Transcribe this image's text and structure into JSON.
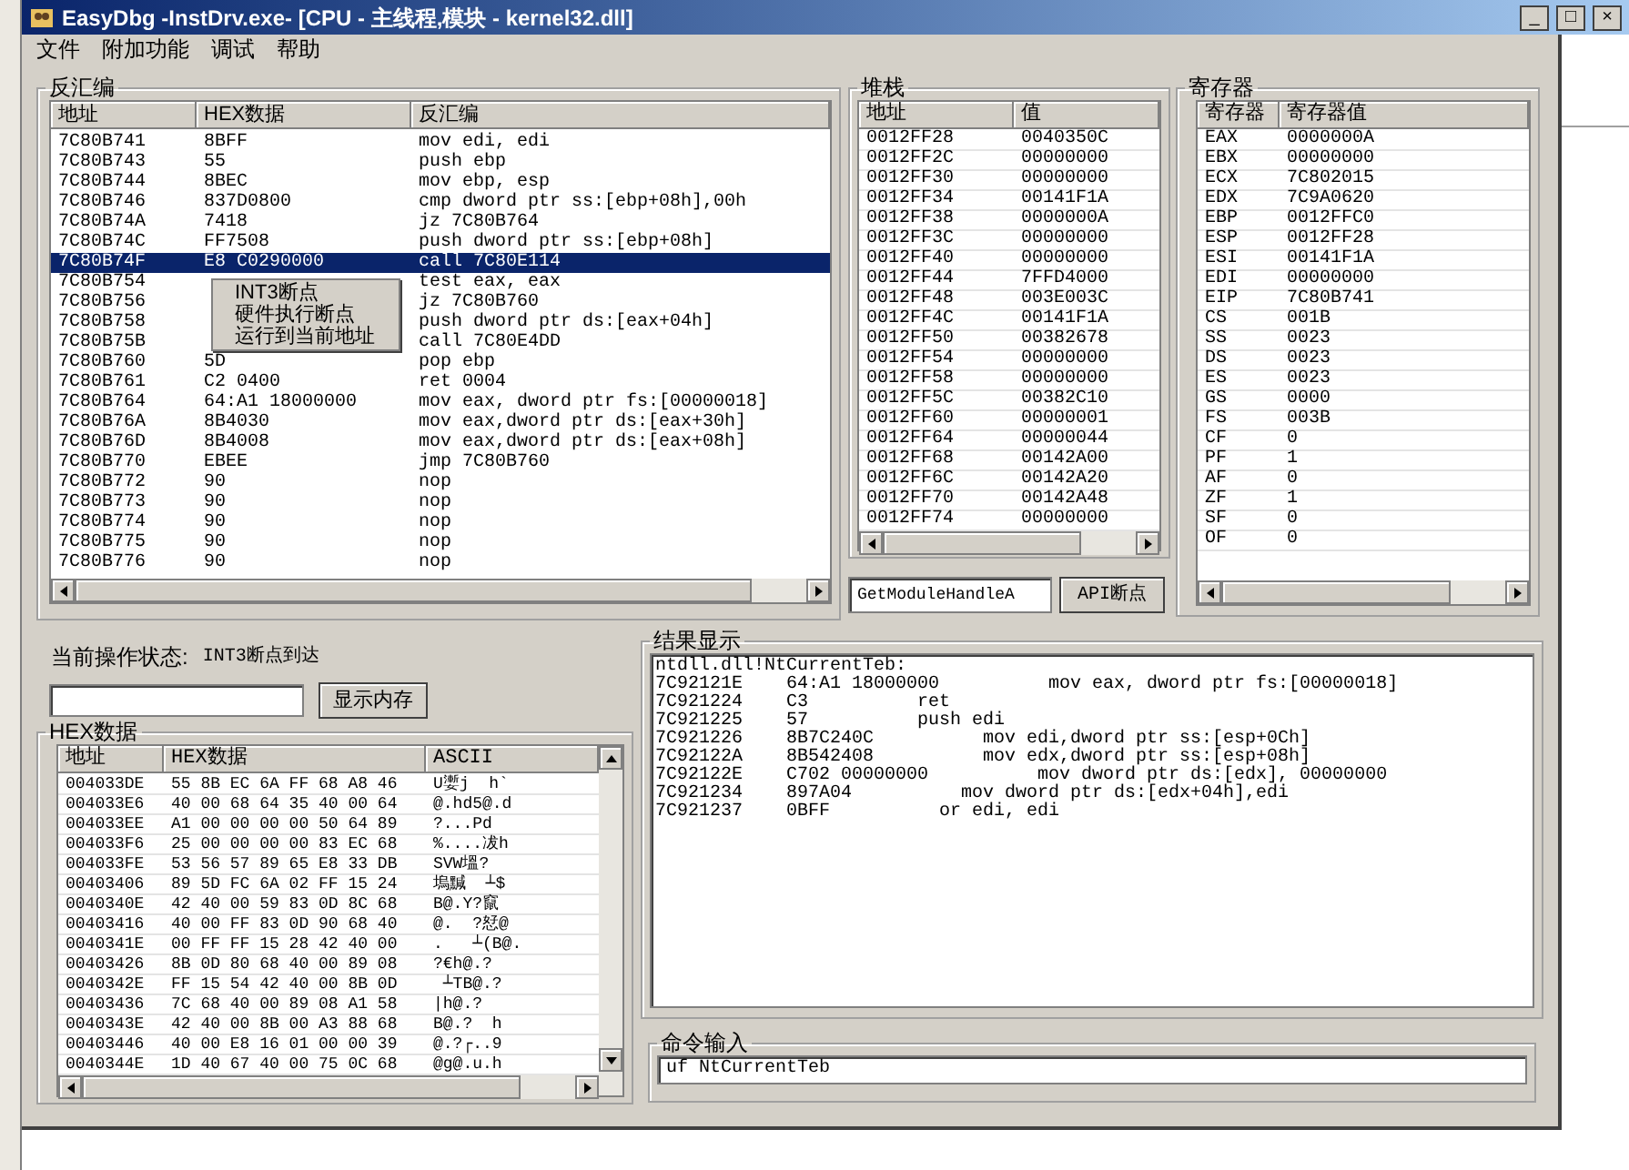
{
  "window": {
    "title": "EasyDbg -InstDrv.exe- [CPU - 主线程,模块 - kernel32.dll]",
    "controls": [
      "_",
      "□",
      "×"
    ]
  },
  "menu": [
    "文件",
    "附加功能",
    "调试",
    "帮助"
  ],
  "disassembly": {
    "label": "反汇编",
    "columns": [
      "地址",
      "HEX数据",
      "反汇编"
    ],
    "rows": [
      {
        "address": "7C80B741",
        "hex": "8BFF",
        "asm": "mov edi, edi",
        "selected": false
      },
      {
        "address": "7C80B743",
        "hex": "55",
        "asm": "push ebp",
        "selected": false
      },
      {
        "address": "7C80B744",
        "hex": "8BEC",
        "asm": "mov ebp, esp",
        "selected": false
      },
      {
        "address": "7C80B746",
        "hex": "837D0800",
        "asm": "cmp dword ptr ss:[ebp+08h],00h",
        "selected": false
      },
      {
        "address": "7C80B74A",
        "hex": "7418",
        "asm": "jz 7C80B764",
        "selected": false
      },
      {
        "address": "7C80B74C",
        "hex": "FF7508",
        "asm": "push dword ptr ss:[ebp+08h]",
        "selected": false
      },
      {
        "address": "7C80B74F",
        "hex": "E8 C0290000",
        "asm": "call 7C80E114",
        "selected": true
      },
      {
        "address": "7C80B754",
        "asm": "test eax, eax",
        "selected": false
      },
      {
        "address": "7C80B756",
        "asm": "jz 7C80B760",
        "selected": false
      },
      {
        "address": "7C80B758",
        "asm": "push dword ptr ds:[eax+04h]",
        "selected": false
      },
      {
        "address": "7C80B75B",
        "asm": "call 7C80E4DD",
        "selected": false
      },
      {
        "address": "7C80B760",
        "hex": "5D",
        "asm": "pop ebp",
        "selected": false
      },
      {
        "address": "7C80B761",
        "hex": "C2 0400",
        "asm": "ret 0004",
        "selected": false
      },
      {
        "address": "7C80B764",
        "hex": "64:A1 18000000",
        "asm": "mov eax, dword ptr fs:[00000018]",
        "selected": false
      },
      {
        "address": "7C80B76A",
        "hex": "8B4030",
        "asm": "mov eax,dword ptr ds:[eax+30h]",
        "selected": false
      },
      {
        "address": "7C80B76D",
        "hex": "8B4008",
        "asm": "mov eax,dword ptr ds:[eax+08h]",
        "selected": false
      },
      {
        "address": "7C80B770",
        "hex": "EBEE",
        "asm": "jmp 7C80B760",
        "selected": false
      },
      {
        "address": "7C80B772",
        "hex": "90",
        "asm": "nop",
        "selected": false
      },
      {
        "address": "7C80B773",
        "hex": "90",
        "asm": "nop",
        "selected": false
      },
      {
        "address": "7C80B774",
        "hex": "90",
        "asm": "nop",
        "selected": false
      },
      {
        "address": "7C80B775",
        "hex": "90",
        "asm": "nop",
        "selected": false
      },
      {
        "address": "7C80B776",
        "hex": "90",
        "asm": "nop",
        "selected": false
      }
    ]
  },
  "context_menu": [
    "INT3断点",
    "硬件执行断点",
    "运行到当前地址"
  ],
  "stack": {
    "label": "堆栈",
    "columns": [
      "地址",
      "值"
    ],
    "rows": [
      [
        "0012FF28",
        "0040350C"
      ],
      [
        "0012FF2C",
        "00000000"
      ],
      [
        "0012FF30",
        "00000000"
      ],
      [
        "0012FF34",
        "00141F1A"
      ],
      [
        "0012FF38",
        "0000000A"
      ],
      [
        "0012FF3C",
        "00000000"
      ],
      [
        "0012FF40",
        "00000000"
      ],
      [
        "0012FF44",
        "7FFD4000"
      ],
      [
        "0012FF48",
        "003E003C"
      ],
      [
        "0012FF4C",
        "00141F1A"
      ],
      [
        "0012FF50",
        "00382678"
      ],
      [
        "0012FF54",
        "00000000"
      ],
      [
        "0012FF58",
        "00000000"
      ],
      [
        "0012FF5C",
        "00382C10"
      ],
      [
        "0012FF60",
        "00000001"
      ],
      [
        "0012FF64",
        "00000044"
      ],
      [
        "0012FF68",
        "00142A00"
      ],
      [
        "0012FF6C",
        "00142A20"
      ],
      [
        "0012FF70",
        "00142A48"
      ],
      [
        "0012FF74",
        "00000000"
      ]
    ],
    "api_field": "GetModuleHandleA",
    "api_button": "API断点"
  },
  "registers": {
    "label": "寄存器",
    "columns": [
      "寄存器",
      "寄存器值"
    ],
    "rows": [
      [
        "EAX",
        "0000000A"
      ],
      [
        "EBX",
        "00000000"
      ],
      [
        "ECX",
        "7C802015"
      ],
      [
        "EDX",
        "7C9A0620"
      ],
      [
        "EBP",
        "0012FFC0"
      ],
      [
        "ESP",
        "0012FF28"
      ],
      [
        "ESI",
        "00141F1A"
      ],
      [
        "EDI",
        "00000000"
      ],
      [
        "EIP",
        "7C80B741"
      ],
      [
        "CS",
        "001B"
      ],
      [
        "SS",
        "0023"
      ],
      [
        "DS",
        "0023"
      ],
      [
        "ES",
        "0023"
      ],
      [
        "GS",
        "0000"
      ],
      [
        "FS",
        "003B"
      ],
      [
        "CF",
        "0"
      ],
      [
        "PF",
        "1"
      ],
      [
        "AF",
        "0"
      ],
      [
        "ZF",
        "1"
      ],
      [
        "SF",
        "0"
      ],
      [
        "OF",
        "0"
      ]
    ]
  },
  "status": {
    "label": "当前操作状态:",
    "value": "INT3断点到达"
  },
  "memory_button": "显示内存",
  "hex_view": {
    "label": "HEX数据",
    "columns": [
      "地址",
      "HEX数据",
      "ASCII"
    ],
    "rows": [
      [
        "004033DE",
        "55 8B EC 6A FF 68 A8 46",
        "U嬱j  h`"
      ],
      [
        "004033E6",
        "40 00 68 64 35 40 00 64",
        "@.hd5@.d"
      ],
      [
        "004033EE",
        "A1 00 00 00 00 50 64 89",
        "?...Pd"
      ],
      [
        "004033F6",
        "25 00 00 00 00 83 EC 68",
        "%....冹h"
      ],
      [
        "004033FE",
        "53 56 57 89 65 E8 33 DB",
        "SVW塭?"
      ],
      [
        "00403406",
        "89 5D FC 6A 02 FF 15 24",
        "塢黬  ┴$"
      ],
      [
        "0040340E",
        "42 40 00 59 83 0D 8C 68",
        "B@.Y?竄"
      ],
      [
        "00403416",
        "40 00 FF 83 0D 90 68 40",
        "@.  ?恏@"
      ],
      [
        "0040341E",
        "00 FF FF 15 28 42 40 00",
        ".   ┴(B@."
      ],
      [
        "00403426",
        "8B 0D 80 68 40 00 89 08",
        "?€h@.?"
      ],
      [
        "0040342E",
        "FF 15 54 42 40 00 8B 0D",
        " ┴TB@.?"
      ],
      [
        "00403436",
        "7C 68 40 00 89 08 A1 58",
        "|h@.?"
      ],
      [
        "0040343E",
        "42 40 00 8B 00 A3 88 68",
        "B@.?  h"
      ],
      [
        "00403446",
        "40 00 E8 16 01 00 00 39",
        "@.?┌..9"
      ],
      [
        "0040344E",
        "1D 40 67 40 00 75 0C 68",
        "@g@.u.h"
      ]
    ]
  },
  "results": {
    "label": "结果显示",
    "lines": [
      "ntdll.dll!NtCurrentTeb:",
      "7C92121E    64:A1 18000000          mov eax, dword ptr fs:[00000018]",
      "7C921224    C3          ret",
      "7C921225    57          push edi",
      "7C921226    8B7C240C          mov edi,dword ptr ss:[esp+0Ch]",
      "7C92122A    8B542408          mov edx,dword ptr ss:[esp+08h]",
      "7C92122E    C702 00000000          mov dword ptr ds:[edx], 00000000",
      "7C921234    897A04          mov dword ptr ds:[edx+04h],edi",
      "7C921237    0BFF          or edi, edi"
    ]
  },
  "command": {
    "label": "命令输入",
    "value": "uf NtCurrentTeb"
  }
}
